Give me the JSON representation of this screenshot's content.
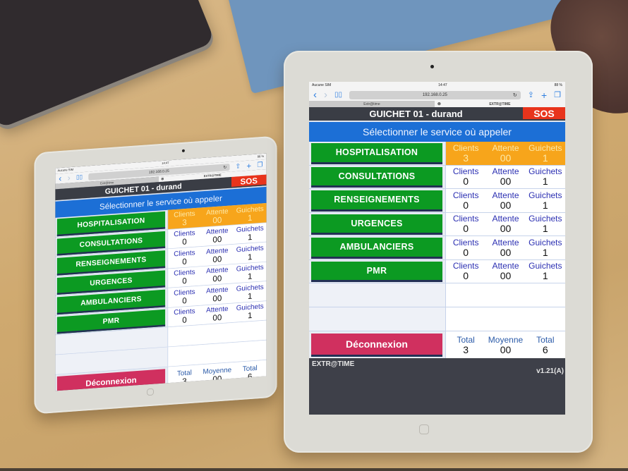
{
  "browser": {
    "carrier": "Aucune SIM",
    "time": "14:47",
    "battery": "88 %",
    "url": "192.168.0.25",
    "tabs": [
      {
        "label": "Extr@time",
        "active": false
      },
      {
        "label": "EXTR@TIME",
        "active": true
      }
    ],
    "icons": {
      "back": "‹",
      "forward": "›",
      "bookmarks": "📖",
      "reload": "↻",
      "share": "⇪",
      "new_tab": "+",
      "tabs": "❐",
      "close_tab": "⊗"
    }
  },
  "app": {
    "title": "GUICHET 01 - durand",
    "sos_label": "SOS",
    "banner": "Sélectionner le service où appeler",
    "services": [
      {
        "name": "HOSPITALISATION",
        "clients_label": "Clients",
        "clients": "3",
        "attente_label": "Attente",
        "attente": "00",
        "guichets_label": "Guichets",
        "guichets": "1",
        "highlight": true
      },
      {
        "name": "CONSULTATIONS",
        "clients_label": "Clients",
        "clients": "0",
        "attente_label": "Attente",
        "attente": "00",
        "guichets_label": "Guichets",
        "guichets": "1",
        "highlight": false
      },
      {
        "name": "RENSEIGNEMENTS",
        "clients_label": "Clients",
        "clients": "0",
        "attente_label": "Attente",
        "attente": "00",
        "guichets_label": "Guichets",
        "guichets": "1",
        "highlight": false
      },
      {
        "name": "URGENCES",
        "clients_label": "Clients",
        "clients": "0",
        "attente_label": "Attente",
        "attente": "00",
        "guichets_label": "Guichets",
        "guichets": "1",
        "highlight": false
      },
      {
        "name": "AMBULANCIERS",
        "clients_label": "Clients",
        "clients": "0",
        "attente_label": "Attente",
        "attente": "00",
        "guichets_label": "Guichets",
        "guichets": "1",
        "highlight": false
      },
      {
        "name": "PMR",
        "clients_label": "Clients",
        "clients": "0",
        "attente_label": "Attente",
        "attente": "00",
        "guichets_label": "Guichets",
        "guichets": "1",
        "highlight": false
      }
    ],
    "logout_label": "Déconnexion",
    "totals": [
      {
        "label": "Total",
        "value": "3"
      },
      {
        "label": "Moyenne",
        "value": "00"
      },
      {
        "label": "Total",
        "value": "6"
      }
    ],
    "brand": "EXTR@TIME",
    "version": "v1.21(A)"
  },
  "colors": {
    "service_button": "#0c9a22",
    "highlight_row": "#f7a51b",
    "banner": "#1c6fd6",
    "sos": "#e8341c",
    "logout": "#d0305f",
    "header": "#3a3d45",
    "stat_label": "#2b2fb2"
  }
}
